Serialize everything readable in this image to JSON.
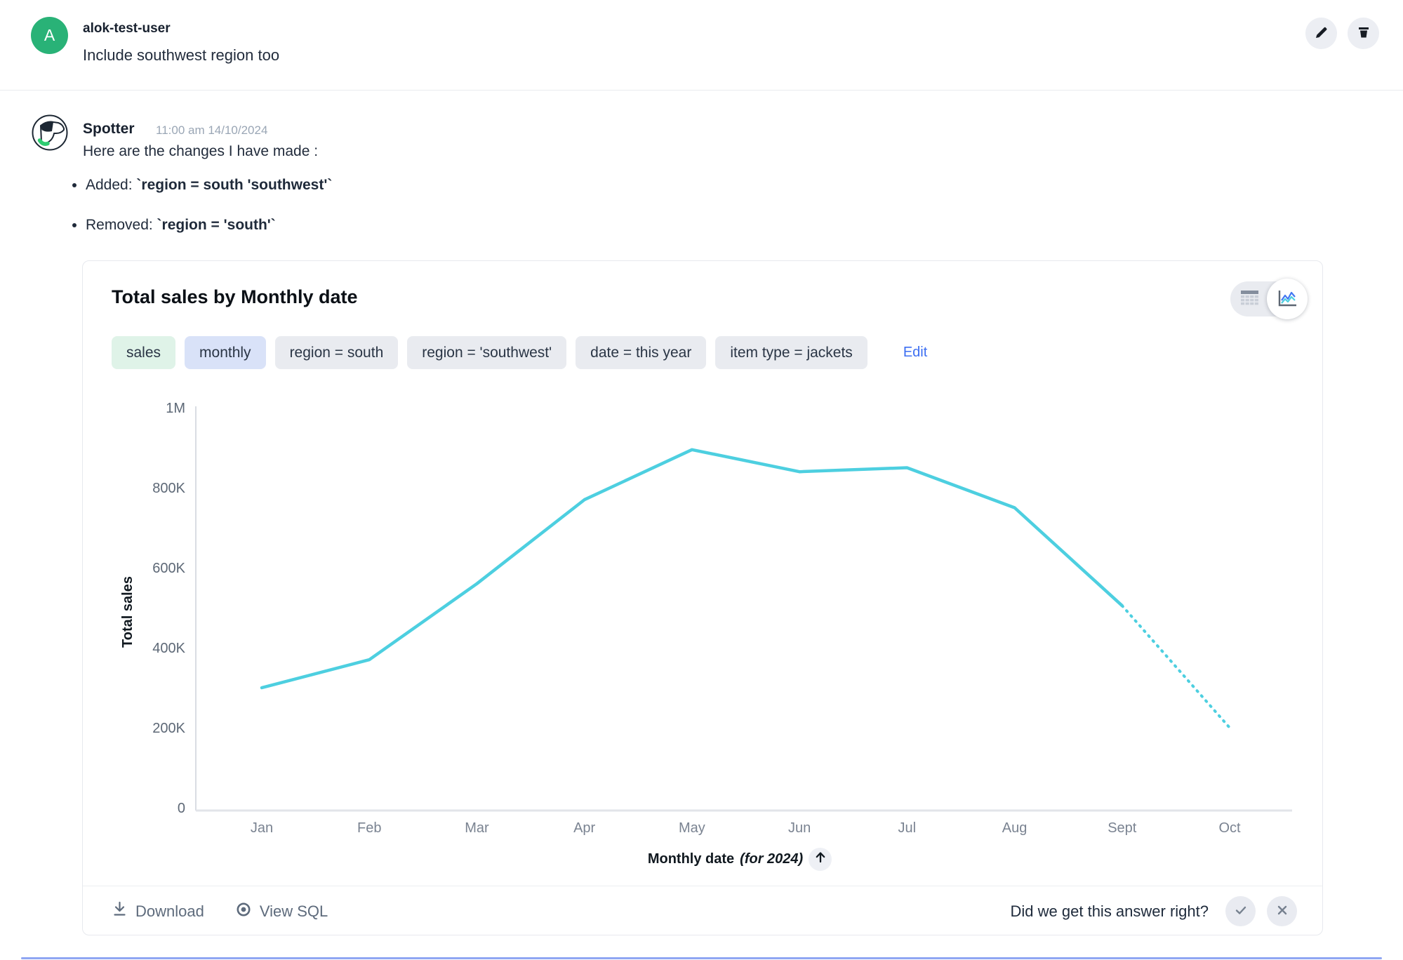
{
  "user_message": {
    "avatar_initial": "A",
    "username": "alok-test-user",
    "text": "Include southwest region too"
  },
  "assistant": {
    "name": "Spotter",
    "timestamp": "11:00 am 14/10/2024",
    "intro": "Here are the changes I have made :",
    "bullets": [
      {
        "prefix": "Added: ",
        "code": "`region = south 'southwest'`"
      },
      {
        "prefix": "Removed: ",
        "code": "`region = 'south'`"
      }
    ]
  },
  "card": {
    "title": "Total sales by Monthly date",
    "view_toggle": {
      "options": [
        "table-view",
        "chart-view"
      ],
      "selected": "chart-view"
    },
    "chips": [
      {
        "label": "sales",
        "color": "#dff3e8"
      },
      {
        "label": "monthly",
        "color": "#d9e2f8"
      },
      {
        "label": "region = south",
        "color": "#e9ebf0"
      },
      {
        "label": "region = 'southwest'",
        "color": "#e9ebf0"
      },
      {
        "label": "date = this year",
        "color": "#e9ebf0"
      },
      {
        "label": "item type = jackets",
        "color": "#e9ebf0"
      }
    ],
    "edit_label": "Edit",
    "footer": {
      "download_label": "Download",
      "view_sql_label": "View SQL",
      "feedback_question": "Did we get this answer right?"
    }
  },
  "chart_data": {
    "type": "line",
    "title": "Total sales by Monthly date",
    "x": [
      "Jan",
      "Feb",
      "Mar",
      "Apr",
      "May",
      "Jun",
      "Jul",
      "Aug",
      "Sept",
      "Oct"
    ],
    "series": [
      {
        "name": "Total sales",
        "values": [
          300000,
          370000,
          560000,
          770000,
          895000,
          840000,
          850000,
          750000,
          505000,
          200000
        ],
        "solid_until": "Sept",
        "dotted_segment": [
          "Sept",
          "Oct"
        ]
      }
    ],
    "xlabel": "Monthly date",
    "xlabel_suffix": "(for 2024)",
    "ylabel": "Total sales",
    "ylim": [
      0,
      1000000
    ],
    "yticks": [
      {
        "label": "1M",
        "value": 1000000
      },
      {
        "label": "800K",
        "value": 800000
      },
      {
        "label": "600K",
        "value": 600000
      },
      {
        "label": "400K",
        "value": 400000
      },
      {
        "label": "200K",
        "value": 200000
      },
      {
        "label": "0",
        "value": 0
      }
    ],
    "line_color": "#4dcfe0",
    "grid": false,
    "legend": "none"
  },
  "colors": {
    "accent_blue": "#3d6ff2",
    "avatar_green": "#29b277",
    "line_cyan": "#4dcfe0"
  }
}
